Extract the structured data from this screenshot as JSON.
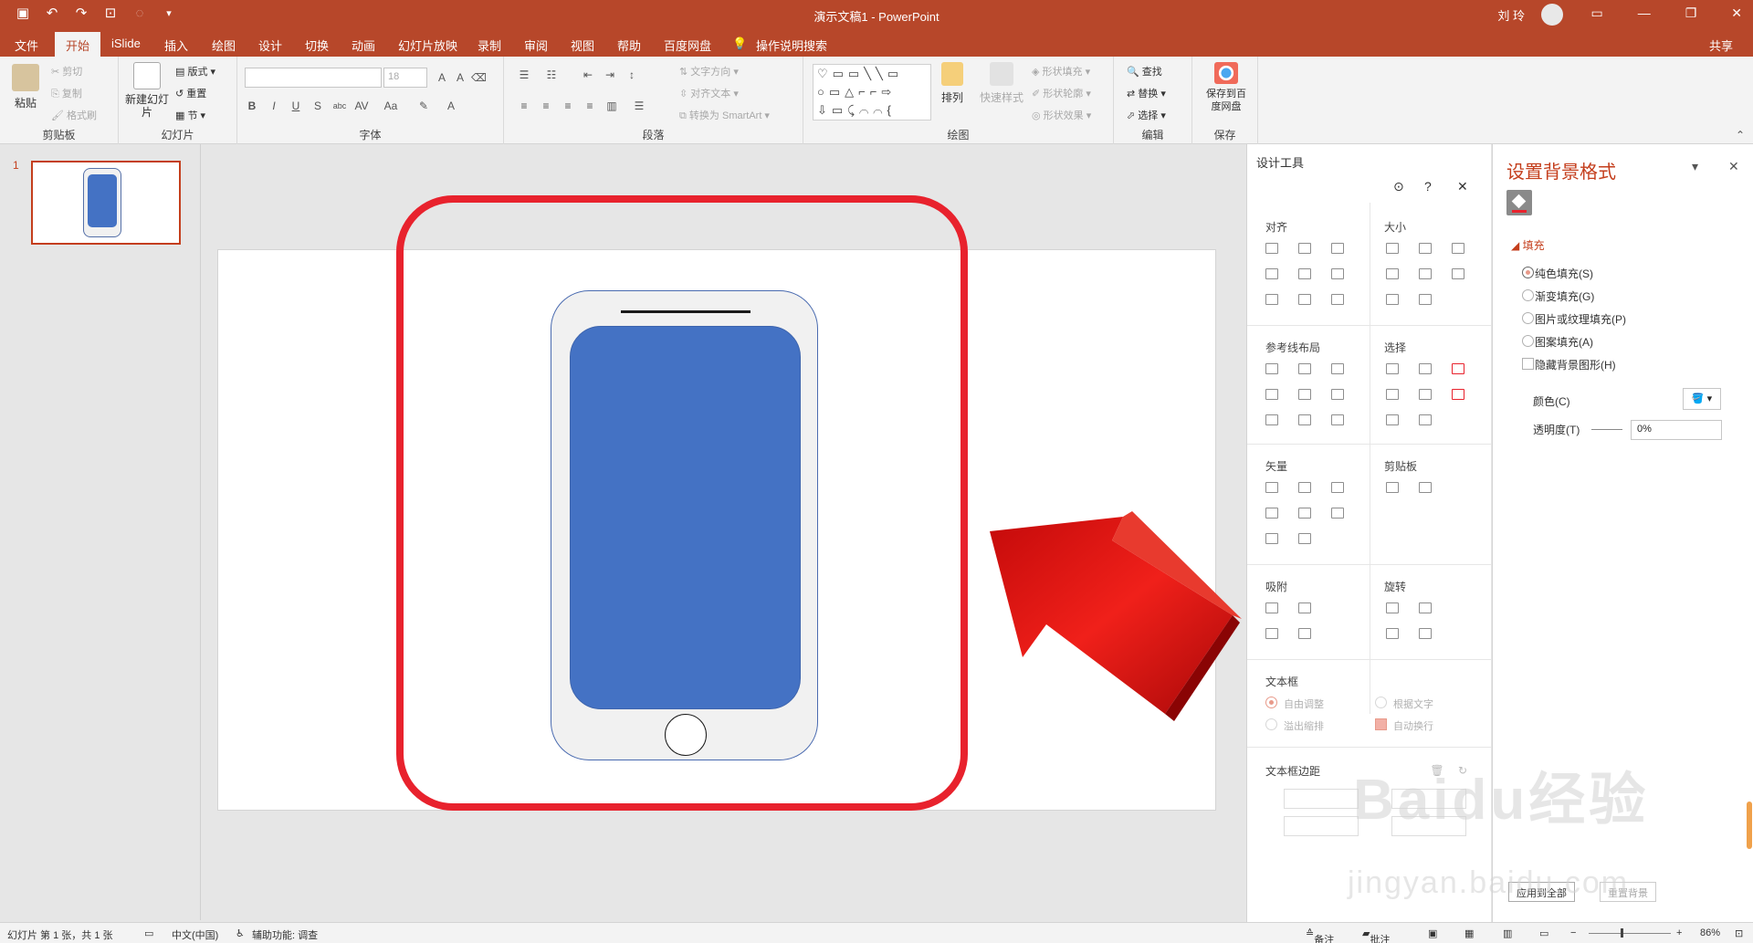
{
  "titlebar": {
    "doc_title": "演示文稿1  -  PowerPoint",
    "user": "刘 玲"
  },
  "tabs": [
    "文件",
    "开始",
    "iSlide",
    "插入",
    "绘图",
    "设计",
    "切换",
    "动画",
    "幻灯片放映",
    "录制",
    "审阅",
    "视图",
    "帮助",
    "百度网盘"
  ],
  "active_tab": "开始",
  "tell_me": "操作说明搜索",
  "share": "共享",
  "ribbon": {
    "clipboard": {
      "paste": "粘贴",
      "cut": "剪切",
      "copy": "复制",
      "format_painter": "格式刷",
      "label": "剪贴板"
    },
    "slides": {
      "new_slide": "新建幻灯片",
      "layout": "版式",
      "reset": "重置",
      "section": "节",
      "label": "幻灯片"
    },
    "font": {
      "size": "18",
      "label": "字体"
    },
    "paragraph": {
      "text_direction": "文字方向",
      "align_text": "对齐文本",
      "smartart": "转换为 SmartArt",
      "label": "段落"
    },
    "drawing": {
      "arrange": "排列",
      "quick_styles": "快速样式",
      "shape_fill": "形状填充",
      "shape_outline": "形状轮廓",
      "shape_effects": "形状效果",
      "label": "绘图"
    },
    "editing": {
      "find": "查找",
      "replace": "替换",
      "select": "选择",
      "label": "编辑"
    },
    "save": {
      "save_to": "保存到百度网盘",
      "label": "保存"
    }
  },
  "thumbnail": {
    "number": "1"
  },
  "design_panel": {
    "title": "设计工具",
    "sections": {
      "align": "对齐",
      "size": "大小",
      "guides": "参考线布局",
      "select": "选择",
      "vector": "矢量",
      "clipboard": "剪贴板",
      "snap": "吸附",
      "rotate": "旋转",
      "textbox": "文本框",
      "textbox_margin": "文本框边距"
    },
    "textbox_options": {
      "auto_fit": "自由调整",
      "by_text": "根据文字",
      "overflow": "溢出缩排",
      "wrap": "自动换行"
    },
    "buttons": {
      "apply": "应用到全部",
      "reset": "重置背景"
    }
  },
  "bg_pane": {
    "title": "设置背景格式",
    "fill_section": "填充",
    "options": [
      "纯色填充(S)",
      "渐变填充(G)",
      "图片或纹理填充(P)",
      "图案填充(A)"
    ],
    "hide_bg": "隐藏背景图形(H)",
    "color_label": "颜色(C)",
    "transparency_label": "透明度(T)",
    "transparency_value": "0%"
  },
  "watermark": {
    "brand": "Baidu经验",
    "url": "jingyan.baidu.com"
  },
  "status": {
    "slide_info": "幻灯片 第 1 张，共 1 张",
    "language": "中文(中国)",
    "accessibility": "辅助功能: 调查",
    "notes": "备注",
    "comments": "批注",
    "zoom": "86%"
  },
  "colors": {
    "accent": "#b7472a",
    "phone_screen": "#4472c4",
    "highlight": "#e8222d"
  }
}
